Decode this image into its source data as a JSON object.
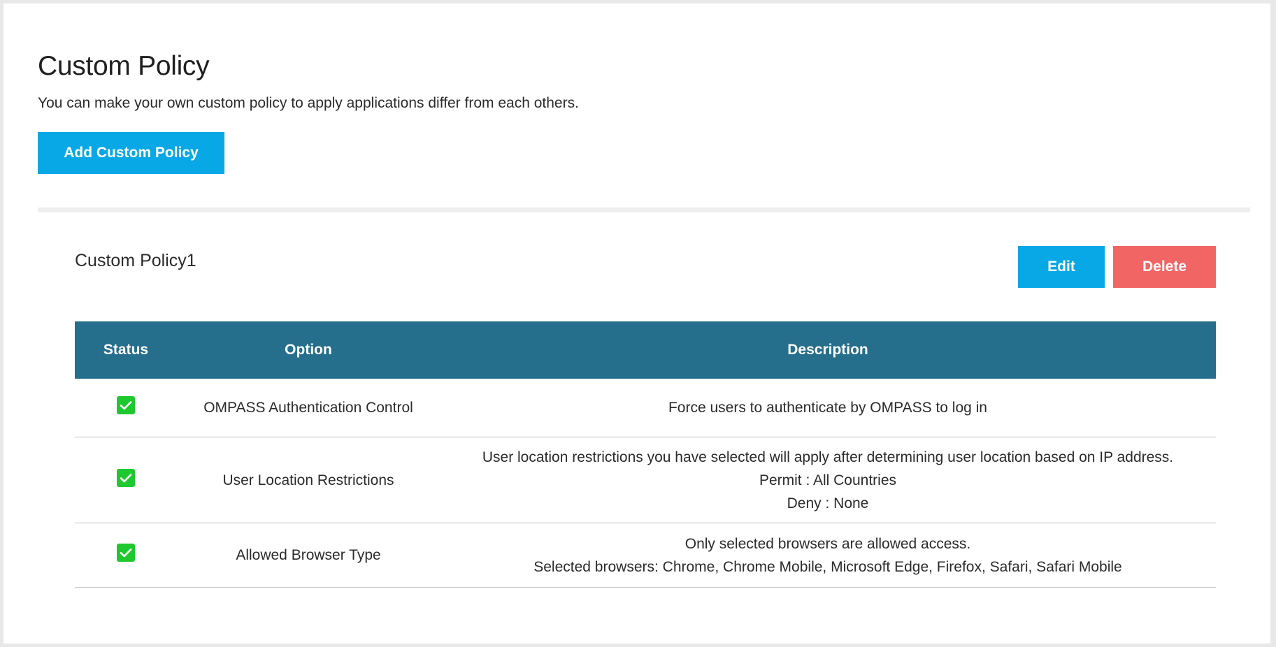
{
  "header": {
    "title": "Custom Policy",
    "description": "You can make your own custom policy to apply applications differ from each others."
  },
  "actions": {
    "add_label": "Add Custom Policy"
  },
  "policy": {
    "name": "Custom Policy1",
    "edit_label": "Edit",
    "delete_label": "Delete",
    "table": {
      "columns": {
        "status": "Status",
        "option": "Option",
        "description": "Description"
      },
      "rows": [
        {
          "status_icon": "checkbox-checked-icon",
          "option": "OMPASS Authentication Control",
          "description": [
            "Force users to authenticate by OMPASS to log in"
          ]
        },
        {
          "status_icon": "checkbox-checked-icon",
          "option": "User Location Restrictions",
          "description": [
            "User location restrictions you have selected will apply after determining user location based on IP address.",
            "Permit : All Countries",
            "Deny : None"
          ]
        },
        {
          "status_icon": "checkbox-checked-icon",
          "option": "Allowed Browser Type",
          "description": [
            "Only selected browsers are allowed access.",
            "Selected browsers: Chrome, Chrome Mobile, Microsoft Edge, Firefox, Safari, Safari Mobile"
          ]
        }
      ]
    }
  },
  "colors": {
    "primary_button": "#08a8e6",
    "danger_button": "#f26565",
    "table_header": "#256e8c",
    "status_enabled": "#1ec92f"
  }
}
